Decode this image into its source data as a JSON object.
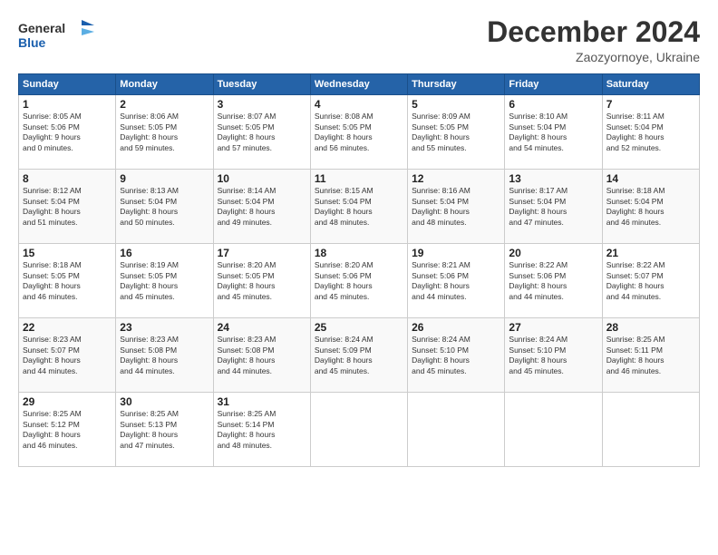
{
  "logo": {
    "line1": "General",
    "line2": "Blue"
  },
  "title": "December 2024",
  "subtitle": "Zaozyornoye, Ukraine",
  "weekdays": [
    "Sunday",
    "Monday",
    "Tuesday",
    "Wednesday",
    "Thursday",
    "Friday",
    "Saturday"
  ],
  "weeks": [
    [
      {
        "day": "1",
        "info": "Sunrise: 8:05 AM\nSunset: 5:06 PM\nDaylight: 9 hours\nand 0 minutes."
      },
      {
        "day": "2",
        "info": "Sunrise: 8:06 AM\nSunset: 5:05 PM\nDaylight: 8 hours\nand 59 minutes."
      },
      {
        "day": "3",
        "info": "Sunrise: 8:07 AM\nSunset: 5:05 PM\nDaylight: 8 hours\nand 57 minutes."
      },
      {
        "day": "4",
        "info": "Sunrise: 8:08 AM\nSunset: 5:05 PM\nDaylight: 8 hours\nand 56 minutes."
      },
      {
        "day": "5",
        "info": "Sunrise: 8:09 AM\nSunset: 5:05 PM\nDaylight: 8 hours\nand 55 minutes."
      },
      {
        "day": "6",
        "info": "Sunrise: 8:10 AM\nSunset: 5:04 PM\nDaylight: 8 hours\nand 54 minutes."
      },
      {
        "day": "7",
        "info": "Sunrise: 8:11 AM\nSunset: 5:04 PM\nDaylight: 8 hours\nand 52 minutes."
      }
    ],
    [
      {
        "day": "8",
        "info": "Sunrise: 8:12 AM\nSunset: 5:04 PM\nDaylight: 8 hours\nand 51 minutes."
      },
      {
        "day": "9",
        "info": "Sunrise: 8:13 AM\nSunset: 5:04 PM\nDaylight: 8 hours\nand 50 minutes."
      },
      {
        "day": "10",
        "info": "Sunrise: 8:14 AM\nSunset: 5:04 PM\nDaylight: 8 hours\nand 49 minutes."
      },
      {
        "day": "11",
        "info": "Sunrise: 8:15 AM\nSunset: 5:04 PM\nDaylight: 8 hours\nand 48 minutes."
      },
      {
        "day": "12",
        "info": "Sunrise: 8:16 AM\nSunset: 5:04 PM\nDaylight: 8 hours\nand 48 minutes."
      },
      {
        "day": "13",
        "info": "Sunrise: 8:17 AM\nSunset: 5:04 PM\nDaylight: 8 hours\nand 47 minutes."
      },
      {
        "day": "14",
        "info": "Sunrise: 8:18 AM\nSunset: 5:04 PM\nDaylight: 8 hours\nand 46 minutes."
      }
    ],
    [
      {
        "day": "15",
        "info": "Sunrise: 8:18 AM\nSunset: 5:05 PM\nDaylight: 8 hours\nand 46 minutes."
      },
      {
        "day": "16",
        "info": "Sunrise: 8:19 AM\nSunset: 5:05 PM\nDaylight: 8 hours\nand 45 minutes."
      },
      {
        "day": "17",
        "info": "Sunrise: 8:20 AM\nSunset: 5:05 PM\nDaylight: 8 hours\nand 45 minutes."
      },
      {
        "day": "18",
        "info": "Sunrise: 8:20 AM\nSunset: 5:06 PM\nDaylight: 8 hours\nand 45 minutes."
      },
      {
        "day": "19",
        "info": "Sunrise: 8:21 AM\nSunset: 5:06 PM\nDaylight: 8 hours\nand 44 minutes."
      },
      {
        "day": "20",
        "info": "Sunrise: 8:22 AM\nSunset: 5:06 PM\nDaylight: 8 hours\nand 44 minutes."
      },
      {
        "day": "21",
        "info": "Sunrise: 8:22 AM\nSunset: 5:07 PM\nDaylight: 8 hours\nand 44 minutes."
      }
    ],
    [
      {
        "day": "22",
        "info": "Sunrise: 8:23 AM\nSunset: 5:07 PM\nDaylight: 8 hours\nand 44 minutes."
      },
      {
        "day": "23",
        "info": "Sunrise: 8:23 AM\nSunset: 5:08 PM\nDaylight: 8 hours\nand 44 minutes."
      },
      {
        "day": "24",
        "info": "Sunrise: 8:23 AM\nSunset: 5:08 PM\nDaylight: 8 hours\nand 44 minutes."
      },
      {
        "day": "25",
        "info": "Sunrise: 8:24 AM\nSunset: 5:09 PM\nDaylight: 8 hours\nand 45 minutes."
      },
      {
        "day": "26",
        "info": "Sunrise: 8:24 AM\nSunset: 5:10 PM\nDaylight: 8 hours\nand 45 minutes."
      },
      {
        "day": "27",
        "info": "Sunrise: 8:24 AM\nSunset: 5:10 PM\nDaylight: 8 hours\nand 45 minutes."
      },
      {
        "day": "28",
        "info": "Sunrise: 8:25 AM\nSunset: 5:11 PM\nDaylight: 8 hours\nand 46 minutes."
      }
    ],
    [
      {
        "day": "29",
        "info": "Sunrise: 8:25 AM\nSunset: 5:12 PM\nDaylight: 8 hours\nand 46 minutes."
      },
      {
        "day": "30",
        "info": "Sunrise: 8:25 AM\nSunset: 5:13 PM\nDaylight: 8 hours\nand 47 minutes."
      },
      {
        "day": "31",
        "info": "Sunrise: 8:25 AM\nSunset: 5:14 PM\nDaylight: 8 hours\nand 48 minutes."
      },
      null,
      null,
      null,
      null
    ]
  ]
}
